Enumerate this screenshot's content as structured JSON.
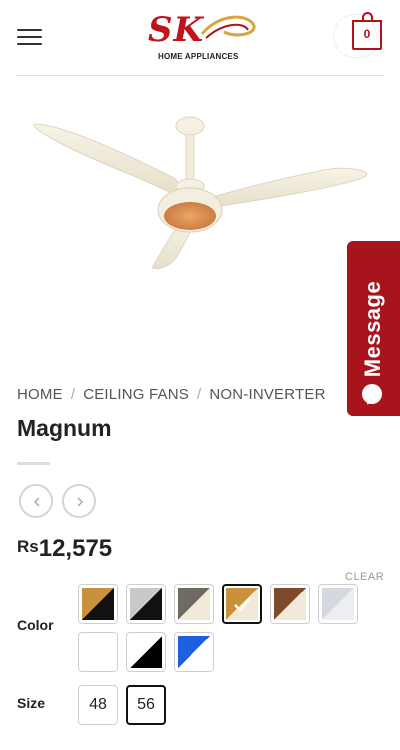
{
  "header": {
    "logo_text": "SK",
    "logo_subtitle": "HOME APPLIANCES",
    "cart_count": "0",
    "brand_color": "#b01219"
  },
  "breadcrumb": {
    "items": [
      "HOME",
      "CEILING FANS",
      "NON-INVERTER"
    ],
    "separator": "/"
  },
  "product": {
    "title": "Magnum",
    "currency": "Rs",
    "price": "12,575"
  },
  "message_widget": {
    "label": "Message",
    "color": "#a8141c"
  },
  "options": {
    "color_label": "Color",
    "clear_label": "CLEAR",
    "swatches": [
      {
        "name": "wood-black",
        "c1": "#c8923d",
        "c2": "#111111",
        "selected": false
      },
      {
        "name": "silver-black",
        "c1": "#c9c9c9",
        "c2": "#111111",
        "selected": false
      },
      {
        "name": "grey-cream",
        "c1": "#6f6a62",
        "c2": "#f1ead9",
        "selected": false
      },
      {
        "name": "wood-cream",
        "c1": "#c8923d",
        "c2": "#f1ead9",
        "selected": true
      },
      {
        "name": "walnut-cream",
        "c1": "#7a4a2a",
        "c2": "#f1ead9",
        "selected": false
      },
      {
        "name": "silver-white",
        "c1": "#d5d8de",
        "c2": "#eceef2",
        "selected": false
      },
      {
        "name": "white",
        "c1": "#ffffff",
        "c2": "#ffffff",
        "selected": false
      },
      {
        "name": "white-black",
        "c1": "#ffffff",
        "c2": "#000000",
        "selected": false
      },
      {
        "name": "blue-white",
        "c1": "#1e5fe0",
        "c2": "#ffffff",
        "selected": false
      }
    ],
    "size_label": "Size",
    "sizes": [
      {
        "label": "48",
        "selected": false
      },
      {
        "label": "56",
        "selected": true
      }
    ]
  }
}
